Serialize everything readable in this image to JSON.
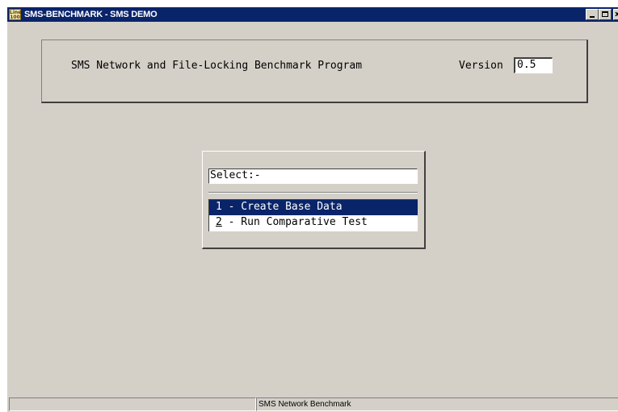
{
  "window": {
    "title": "SMS-BENCHMARK - SMS DEMO",
    "icon": "app-icon",
    "controls": {
      "minimize": "_",
      "maximize": "",
      "close": "x"
    }
  },
  "header": {
    "title": "SMS Network and File-Locking Benchmark Program",
    "version_label": "Version",
    "version_value": "0.5"
  },
  "menu": {
    "select_prompt": "Select:-",
    "items": [
      {
        "key": "1",
        "label": " - Create Base Data",
        "selected": true
      },
      {
        "key": "2",
        "label": " - Run Comparative Test",
        "selected": false
      }
    ]
  },
  "statusbar": {
    "left": "",
    "center": "SMS Network Benchmark"
  },
  "colors": {
    "titlebar": "#0a246a",
    "window_bg": "#d4d0c8",
    "selection": "#0a246a"
  }
}
